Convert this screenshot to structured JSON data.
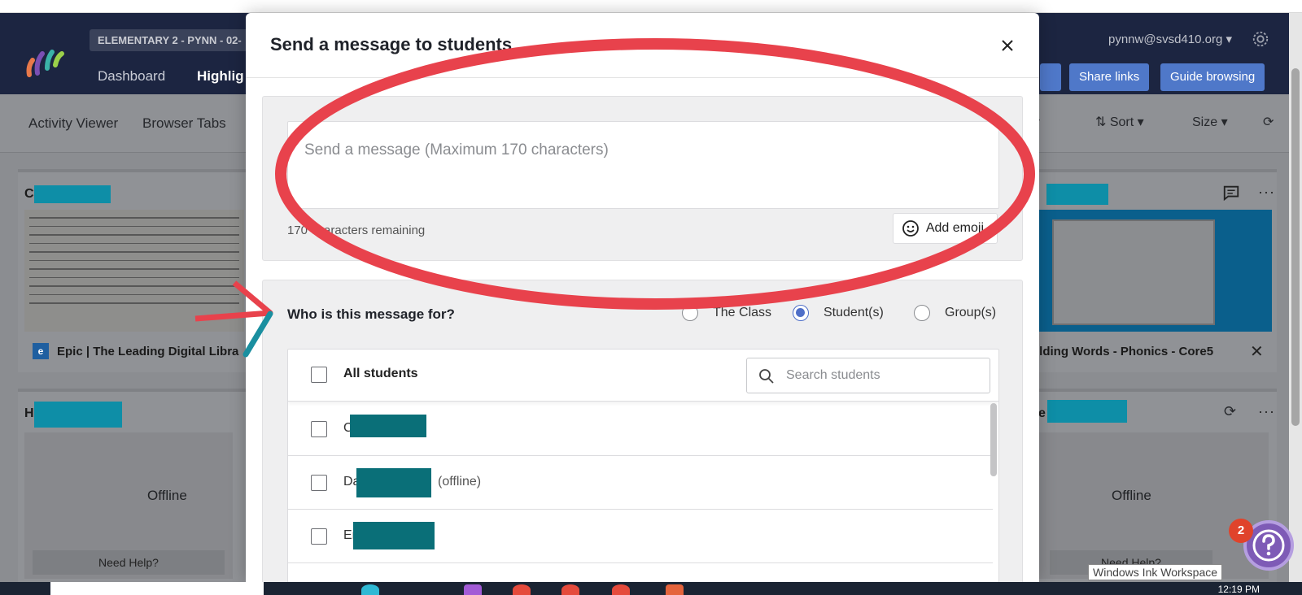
{
  "header": {
    "class_label": "ELEMENTARY 2 - PYNN - 02-",
    "nav": [
      "Dashboard",
      "Highlig"
    ],
    "account": "pynnw@svsd410.org",
    "share_links": "Share links",
    "guide_browsing": "Guide browsing"
  },
  "toolbar": {
    "tabs": [
      "Activity Viewer",
      "Browser Tabs"
    ],
    "sort_label": "Sort",
    "size_label": "Size"
  },
  "cards": {
    "left_top_initial": "C",
    "left_top_site": "Epic | The Leading Digital Libra",
    "right_top_site": "ilding Words - Phonics - Core5",
    "left_bottom_initial": "H",
    "right_bottom_initial": "e",
    "offline": "Offline",
    "need_help": "Need Help?"
  },
  "modal": {
    "title": "Send a message to students",
    "message_placeholder": "Send a message (Maximum 170 characters)",
    "remaining_prefix": "170",
    "remaining_suffix": "characters remaining",
    "add_emoji": "Add emoji",
    "who_label": "Who is this message for?",
    "recipient_options": [
      {
        "label": "The Class",
        "selected": false
      },
      {
        "label": "Student(s)",
        "selected": true
      },
      {
        "label": "Group(s)",
        "selected": false
      }
    ],
    "all_students": "All students",
    "search_placeholder": "Search students",
    "students": [
      {
        "initial": "C",
        "note": ""
      },
      {
        "initial": "Da",
        "note": "(offline)"
      },
      {
        "initial": "Er",
        "note": ""
      }
    ]
  },
  "overlay": {
    "ink_tooltip": "Windows Ink Workspace",
    "help_badge_count": "2",
    "clock": "12:19 PM"
  },
  "colors": {
    "header_bg": "#1c2541",
    "accent_blue": "#4f6fc8",
    "annotation_red": "#e8424c",
    "annotation_teal": "#1a8fa0",
    "redaction": "#0e8ea7"
  }
}
